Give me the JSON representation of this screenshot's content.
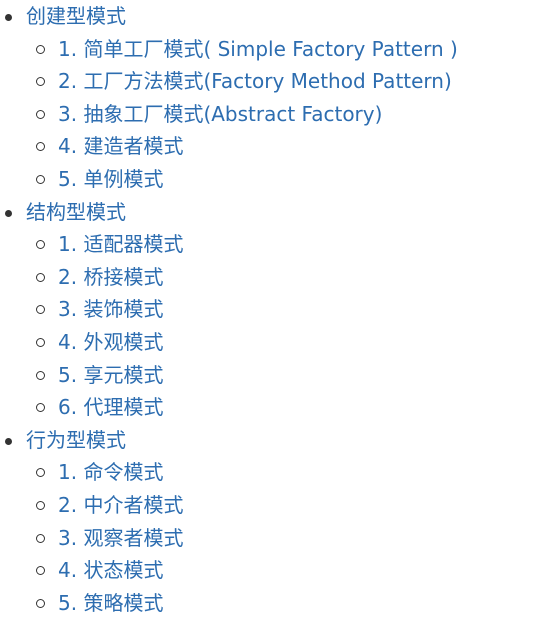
{
  "categories": [
    {
      "label": "创建型模式",
      "items": [
        "1. 简单工厂模式( Simple Factory Pattern )",
        "2. 工厂方法模式(Factory Method Pattern)",
        "3. 抽象工厂模式(Abstract Factory)",
        "4. 建造者模式",
        "5. 单例模式"
      ]
    },
    {
      "label": "结构型模式",
      "items": [
        "1. 适配器模式",
        "2. 桥接模式",
        "3. 装饰模式",
        "4. 外观模式",
        "5. 享元模式",
        "6. 代理模式"
      ]
    },
    {
      "label": "行为型模式",
      "items": [
        "1. 命令模式",
        "2. 中介者模式",
        "3. 观察者模式",
        "4. 状态模式",
        "5. 策略模式"
      ]
    }
  ],
  "colors": {
    "link": "#2d6db0",
    "bullet": "#333333",
    "background": "#ffffff"
  },
  "icons": {
    "category_bullet": "filled-disc-bullet-icon",
    "item_bullet": "hollow-circle-bullet-icon"
  }
}
